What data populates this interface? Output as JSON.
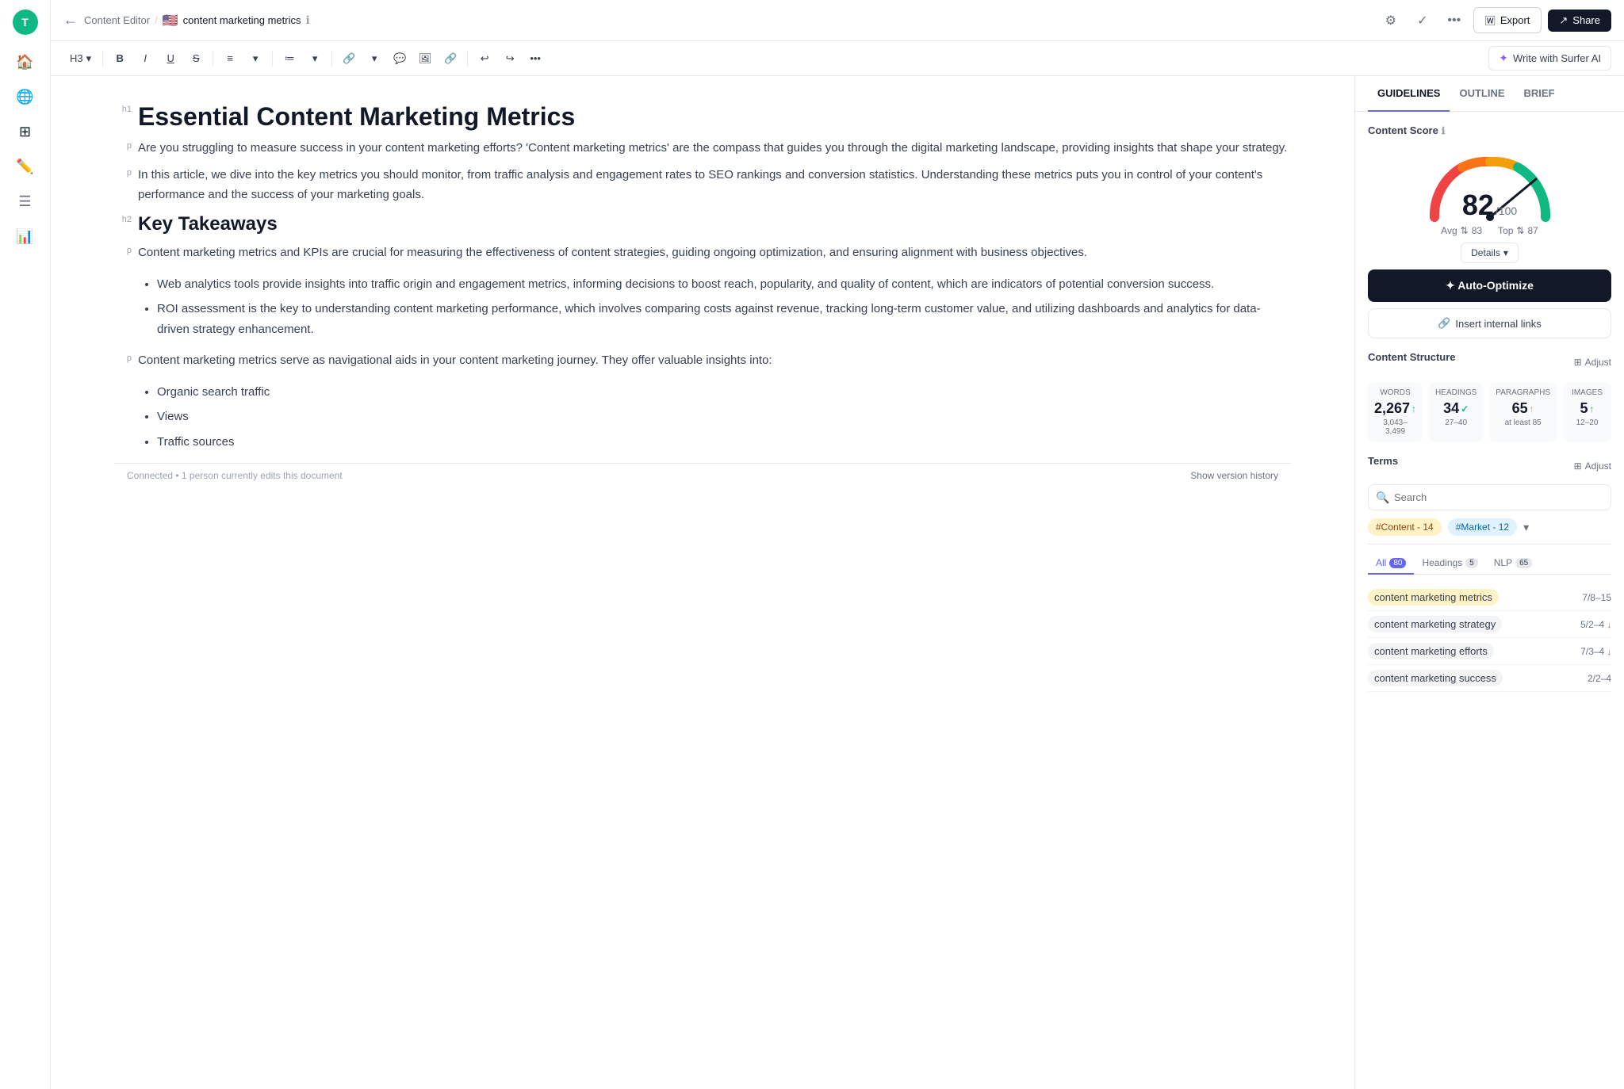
{
  "app": {
    "avatar": "T",
    "breadcrumb": {
      "parent": "Content Editor",
      "separator": "/",
      "flag": "🇺🇸",
      "title": "content marketing metrics"
    },
    "tabs": {
      "guidelines": "GUIDELINES",
      "outline": "OUTLINE",
      "brief": "BRIEF"
    },
    "active_tab": "GUIDELINES"
  },
  "topbar": {
    "export_label": "Export",
    "share_label": "Share",
    "wordpress_icon": "W"
  },
  "toolbar": {
    "heading_level": "H3",
    "write_surfer_label": "Write with Surfer AI",
    "bold": "B",
    "italic": "I",
    "underline": "U",
    "strikethrough": "S",
    "undo": "↩",
    "redo": "↪",
    "more": "•••"
  },
  "editor": {
    "h1": "Essential Content Marketing Metrics",
    "p1": "Are you struggling to measure success in your content marketing efforts? 'Content marketing metrics' are the compass that guides you through the digital marketing landscape, providing insights that shape your strategy.",
    "p2": "In this article, we dive into the key metrics you should monitor, from traffic analysis and engagement rates to SEO rankings and conversion statistics. Understanding these metrics puts you in control of your content's performance and the success of your marketing goals.",
    "h2": "Key Takeaways",
    "p3": "Content marketing metrics and KPIs are crucial for measuring the effectiveness of content strategies, guiding ongoing optimization, and ensuring alignment with business objectives.",
    "bullet1": "Web analytics tools provide insights into traffic origin and engagement metrics, informing decisions to boost reach, popularity, and quality of content, which are indicators of potential conversion success.",
    "bullet2": "ROI assessment is the key to understanding content marketing performance, which involves comparing costs against revenue, tracking long-term customer value, and utilizing dashboards and analytics for data-driven strategy enhancement.",
    "p4": "Content marketing metrics serve as navigational aids in your content marketing journey. They offer valuable insights into:",
    "bullet3": "Organic search traffic",
    "bullet4": "Views",
    "bullet5": "Traffic sources",
    "version_text": "Connected • 1 person currently edits this document",
    "show_history": "Show version history"
  },
  "right_panel": {
    "content_score": {
      "title": "Content Score",
      "score": "82",
      "max": "/100",
      "avg_label": "Avg",
      "avg_value": "83",
      "top_label": "Top",
      "top_value": "87",
      "details_label": "Details"
    },
    "actions": {
      "auto_optimize_label": "✦ Auto-Optimize",
      "internal_links_label": "Insert internal links"
    },
    "structure": {
      "title": "Content Structure",
      "adjust_label": "Adjust",
      "metrics": [
        {
          "label": "WORDS",
          "value": "2,267",
          "indicator": "up",
          "range": "3,043–3,499"
        },
        {
          "label": "HEADINGS",
          "value": "34",
          "indicator": "check",
          "range": "27–40"
        },
        {
          "label": "PARAGRAPHS",
          "value": "65",
          "indicator": "up-orange",
          "range": "at least 85"
        },
        {
          "label": "IMAGES",
          "value": "5",
          "indicator": "up",
          "range": "12–20"
        }
      ]
    },
    "terms": {
      "title": "Terms",
      "adjust_label": "Adjust",
      "search_placeholder": "Search",
      "tags": [
        {
          "label": "#Content - 14",
          "type": "content"
        },
        {
          "label": "#Market - 12",
          "type": "market"
        }
      ],
      "filter_tabs": [
        {
          "label": "All",
          "count": "80",
          "active": true
        },
        {
          "label": "Headings",
          "count": "5",
          "active": false
        },
        {
          "label": "NLP",
          "count": "65",
          "active": false
        }
      ],
      "term_list": [
        {
          "name": "content marketing metrics",
          "range": "7/8–15",
          "arrow": null,
          "highlight": true
        },
        {
          "name": "content marketing strategy",
          "range": "5/2–4",
          "arrow": "down",
          "highlight": false
        },
        {
          "name": "content marketing efforts",
          "range": "7/3–4",
          "arrow": "down",
          "highlight": false
        },
        {
          "name": "content marketing success",
          "range": "2/2–4",
          "arrow": null,
          "highlight": false
        }
      ]
    }
  }
}
